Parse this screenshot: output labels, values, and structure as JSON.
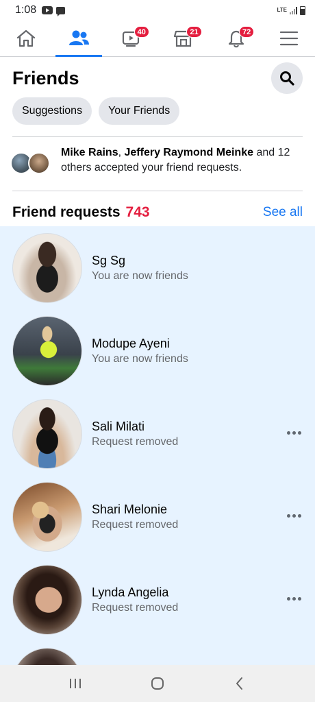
{
  "status_bar": {
    "time": "1:08",
    "network": "LTE"
  },
  "nav": {
    "tabs": [
      {
        "name": "home",
        "icon": "home-icon",
        "badge": ""
      },
      {
        "name": "friends",
        "icon": "friends-icon",
        "badge": "",
        "active": true
      },
      {
        "name": "watch",
        "icon": "video-icon",
        "badge": "40"
      },
      {
        "name": "marketplace",
        "icon": "store-icon",
        "badge": "21"
      },
      {
        "name": "notifications",
        "icon": "bell-icon",
        "badge": "72"
      },
      {
        "name": "menu",
        "icon": "menu-icon",
        "badge": ""
      }
    ]
  },
  "header": {
    "title": "Friends"
  },
  "chips": [
    {
      "label": "Suggestions"
    },
    {
      "label": "Your Friends"
    }
  ],
  "accepted": {
    "name1": "Mike Rains",
    "separator": ", ",
    "name2": "Jeffery Raymond Meinke",
    "rest": " and 12 others accepted your friend requests."
  },
  "requests": {
    "title": "Friend requests",
    "count": "743",
    "see_all": "See all",
    "items": [
      {
        "name": "Sg Sg",
        "status": "You are now friends",
        "has_more": false
      },
      {
        "name": "Modupe Ayeni",
        "status": "You are now friends",
        "has_more": false
      },
      {
        "name": "Sali Milati",
        "status": "Request removed",
        "has_more": true
      },
      {
        "name": "Shari Melonie",
        "status": "Request removed",
        "has_more": true
      },
      {
        "name": "Lynda Angelia",
        "status": "Request removed",
        "has_more": true
      },
      {
        "name": "",
        "status": "",
        "has_more": false
      }
    ]
  },
  "colors": {
    "accent": "#1877f2",
    "badge": "#e41e3f",
    "highlight_bg": "#e7f3ff"
  }
}
